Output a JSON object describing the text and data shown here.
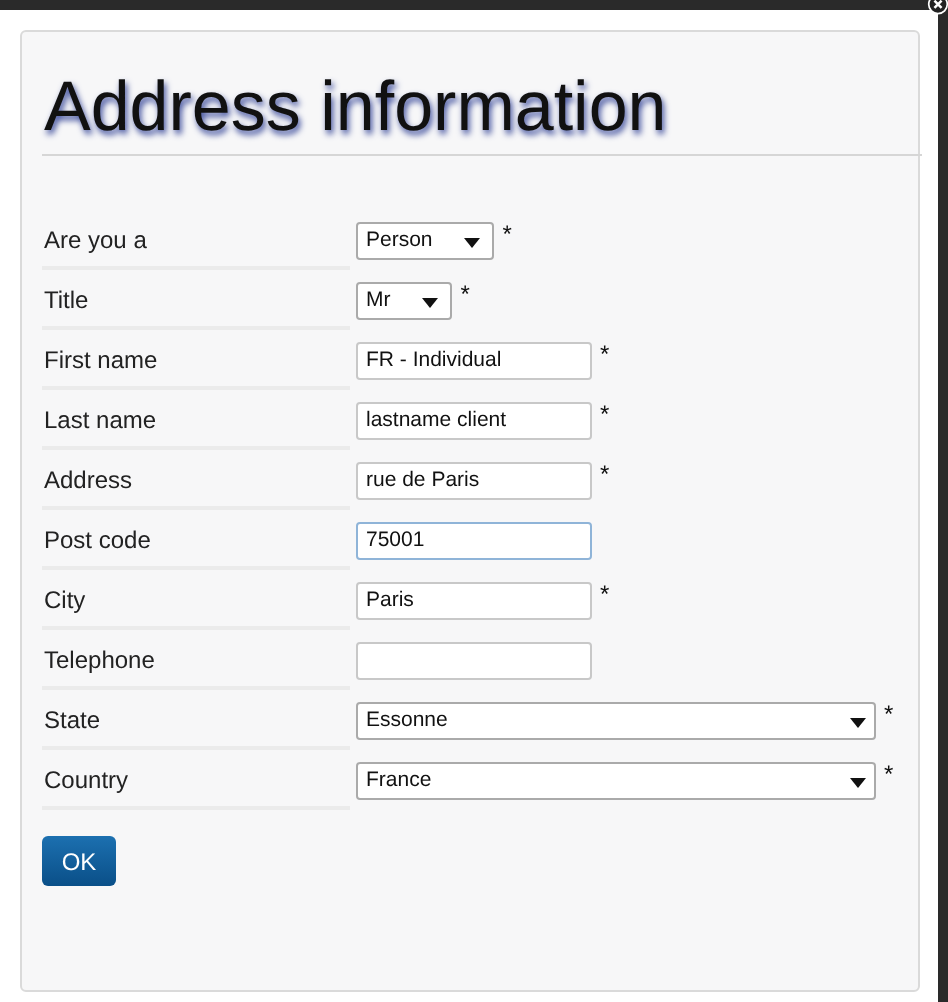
{
  "title": "Address information",
  "fields": [
    {
      "label": "Are you a",
      "kind": "select",
      "value": "Person",
      "mark": "*",
      "focused": false
    },
    {
      "label": "Title",
      "kind": "select",
      "value": "Mr",
      "mark": "*",
      "focused": false
    },
    {
      "label": "First name",
      "kind": "text",
      "value": "FR - Individual",
      "mark": "*",
      "focused": false
    },
    {
      "label": "Last name",
      "kind": "text",
      "value": "lastname client",
      "mark": "*",
      "focused": false
    },
    {
      "label": "Address",
      "kind": "text",
      "value": "rue de Paris",
      "mark": "*",
      "focused": false
    },
    {
      "label": "Post code",
      "kind": "text",
      "value": "75001",
      "focused": true
    },
    {
      "label": "City",
      "kind": "text",
      "value": "Paris",
      "mark": "*",
      "focused": false
    },
    {
      "label": "Telephone",
      "kind": "text",
      "focused": false
    },
    {
      "label": "State",
      "kind": "wideselect",
      "value": "Essonne",
      "mark": "*",
      "focused": false
    },
    {
      "label": "Country",
      "kind": "wideselect",
      "value": "France",
      "mark": "*",
      "focused": false
    }
  ],
  "button": "OK"
}
